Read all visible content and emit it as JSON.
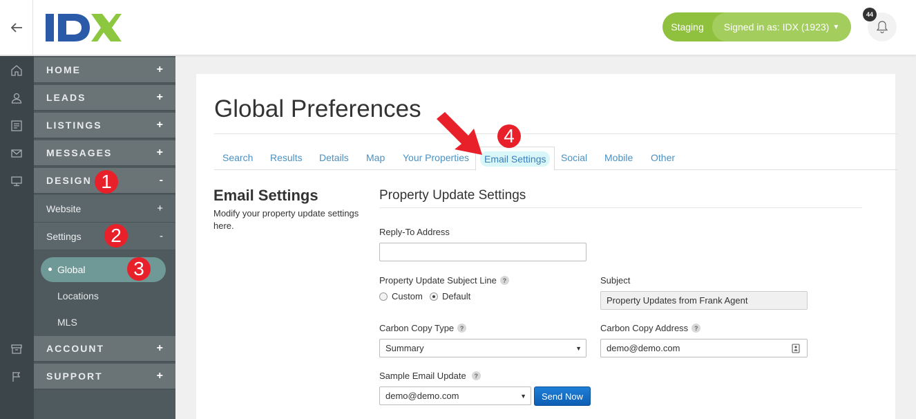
{
  "header": {
    "back_label": "←",
    "staging_label": "Staging",
    "signed_in_label": "Signed in as: IDX (1923)",
    "notification_count": "44"
  },
  "sidebar": {
    "home": "HOME",
    "leads": "LEADS",
    "listings": "LISTINGS",
    "messages": "MESSAGES",
    "design": "DESIGN",
    "website": "Website",
    "settings": "Settings",
    "global": "Global",
    "locations": "Locations",
    "mls": "MLS",
    "account": "ACCOUNT",
    "support": "SUPPORT",
    "expand_sign": "+",
    "collapse_sign": "-"
  },
  "steps": [
    "1",
    "2",
    "3",
    "4"
  ],
  "page": {
    "title": "Global Preferences",
    "tabs": [
      "Search",
      "Results",
      "Details",
      "Map",
      "Your Properties",
      "Email Settings",
      "Social",
      "Mobile",
      "Other"
    ],
    "active_tab": "Email Settings"
  },
  "section": {
    "title": "Email Settings",
    "description": "Modify your property update settings here."
  },
  "form": {
    "fieldset_title": "Property Update Settings",
    "reply_to_label": "Reply-To Address",
    "reply_to_value": "",
    "subject_line_label": "Property Update Subject Line",
    "radio_custom": "Custom",
    "radio_default": "Default",
    "subject_label": "Subject",
    "subject_value": "Property Updates from Frank Agent",
    "cc_type_label": "Carbon Copy Type",
    "cc_type_value": "Summary",
    "cc_address_label": "Carbon Copy Address",
    "cc_address_value": "demo@demo.com",
    "sample_label": "Sample Email Update",
    "sample_value": "demo@demo.com",
    "send_button": "Send Now",
    "help_glyph": "?"
  },
  "colors": {
    "brand_blue": "#2a5aa8",
    "brand_green": "#8dc63f",
    "staging_green": "#8fc13e",
    "step_red": "#e8202a",
    "link_blue": "#4a90c2"
  }
}
